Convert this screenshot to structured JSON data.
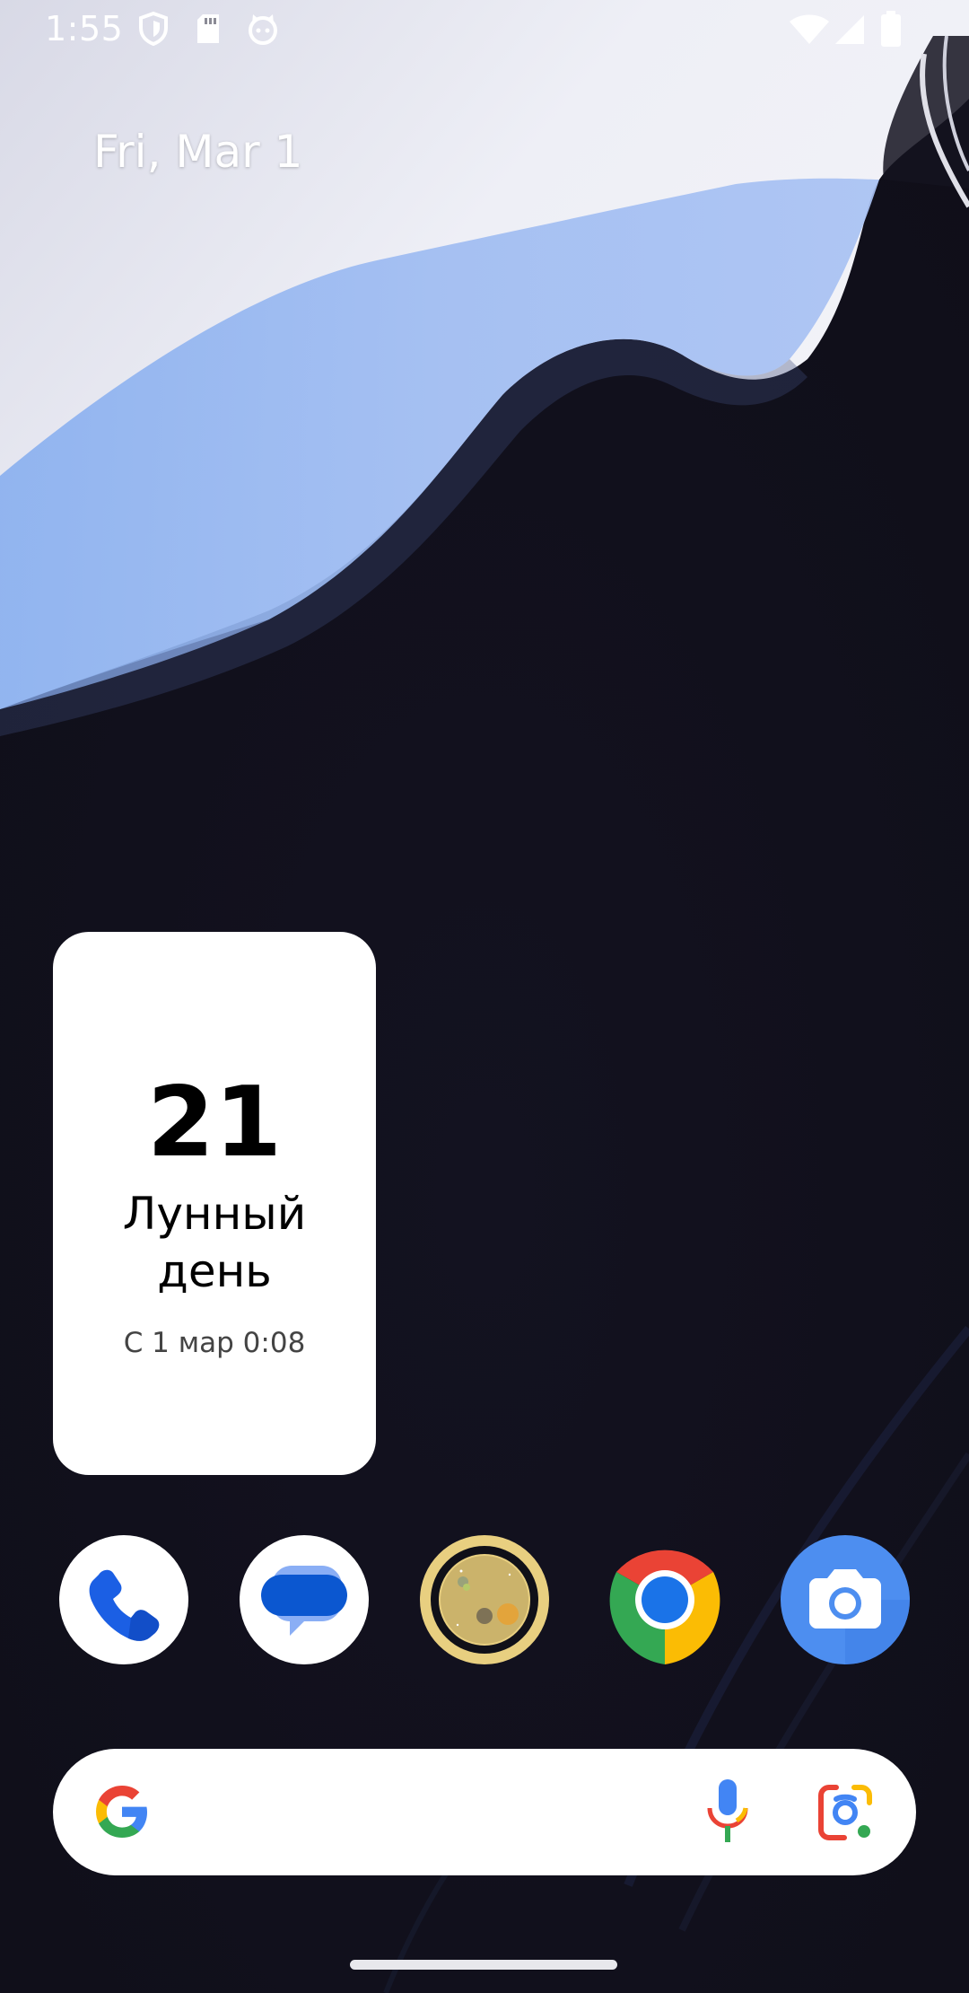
{
  "status_bar": {
    "time": "1:55",
    "left_icons": [
      "shield-icon",
      "sd-card-icon",
      "cat-face-icon"
    ],
    "right_icons": [
      "wifi-icon",
      "cellular-signal-icon",
      "battery-icon"
    ]
  },
  "home": {
    "date": "Fri, Mar 1"
  },
  "moon_widget": {
    "day_number": "21",
    "label": "Лунный день",
    "since": "С 1 мар 0:08"
  },
  "dock": {
    "apps": [
      {
        "icon": "phone-icon",
        "color": "#1a5ee6"
      },
      {
        "icon": "messages-icon",
        "color": "#0b57d0"
      },
      {
        "icon": "moon-app-icon",
        "color": "#e8cf80"
      },
      {
        "icon": "chrome-icon",
        "color": "#1a73e8"
      },
      {
        "icon": "camera-icon",
        "color": "#4d8ef0"
      }
    ]
  },
  "search_bar": {
    "icons": [
      "google-g-icon",
      "microphone-icon",
      "google-lens-icon"
    ]
  },
  "colors": {
    "background": "#12111c",
    "wallpaper_light": "#e6e8f2",
    "wallpaper_blue": "#8ab0ef",
    "widget_bg": "#ffffff",
    "handle": "#e8e8ec"
  }
}
